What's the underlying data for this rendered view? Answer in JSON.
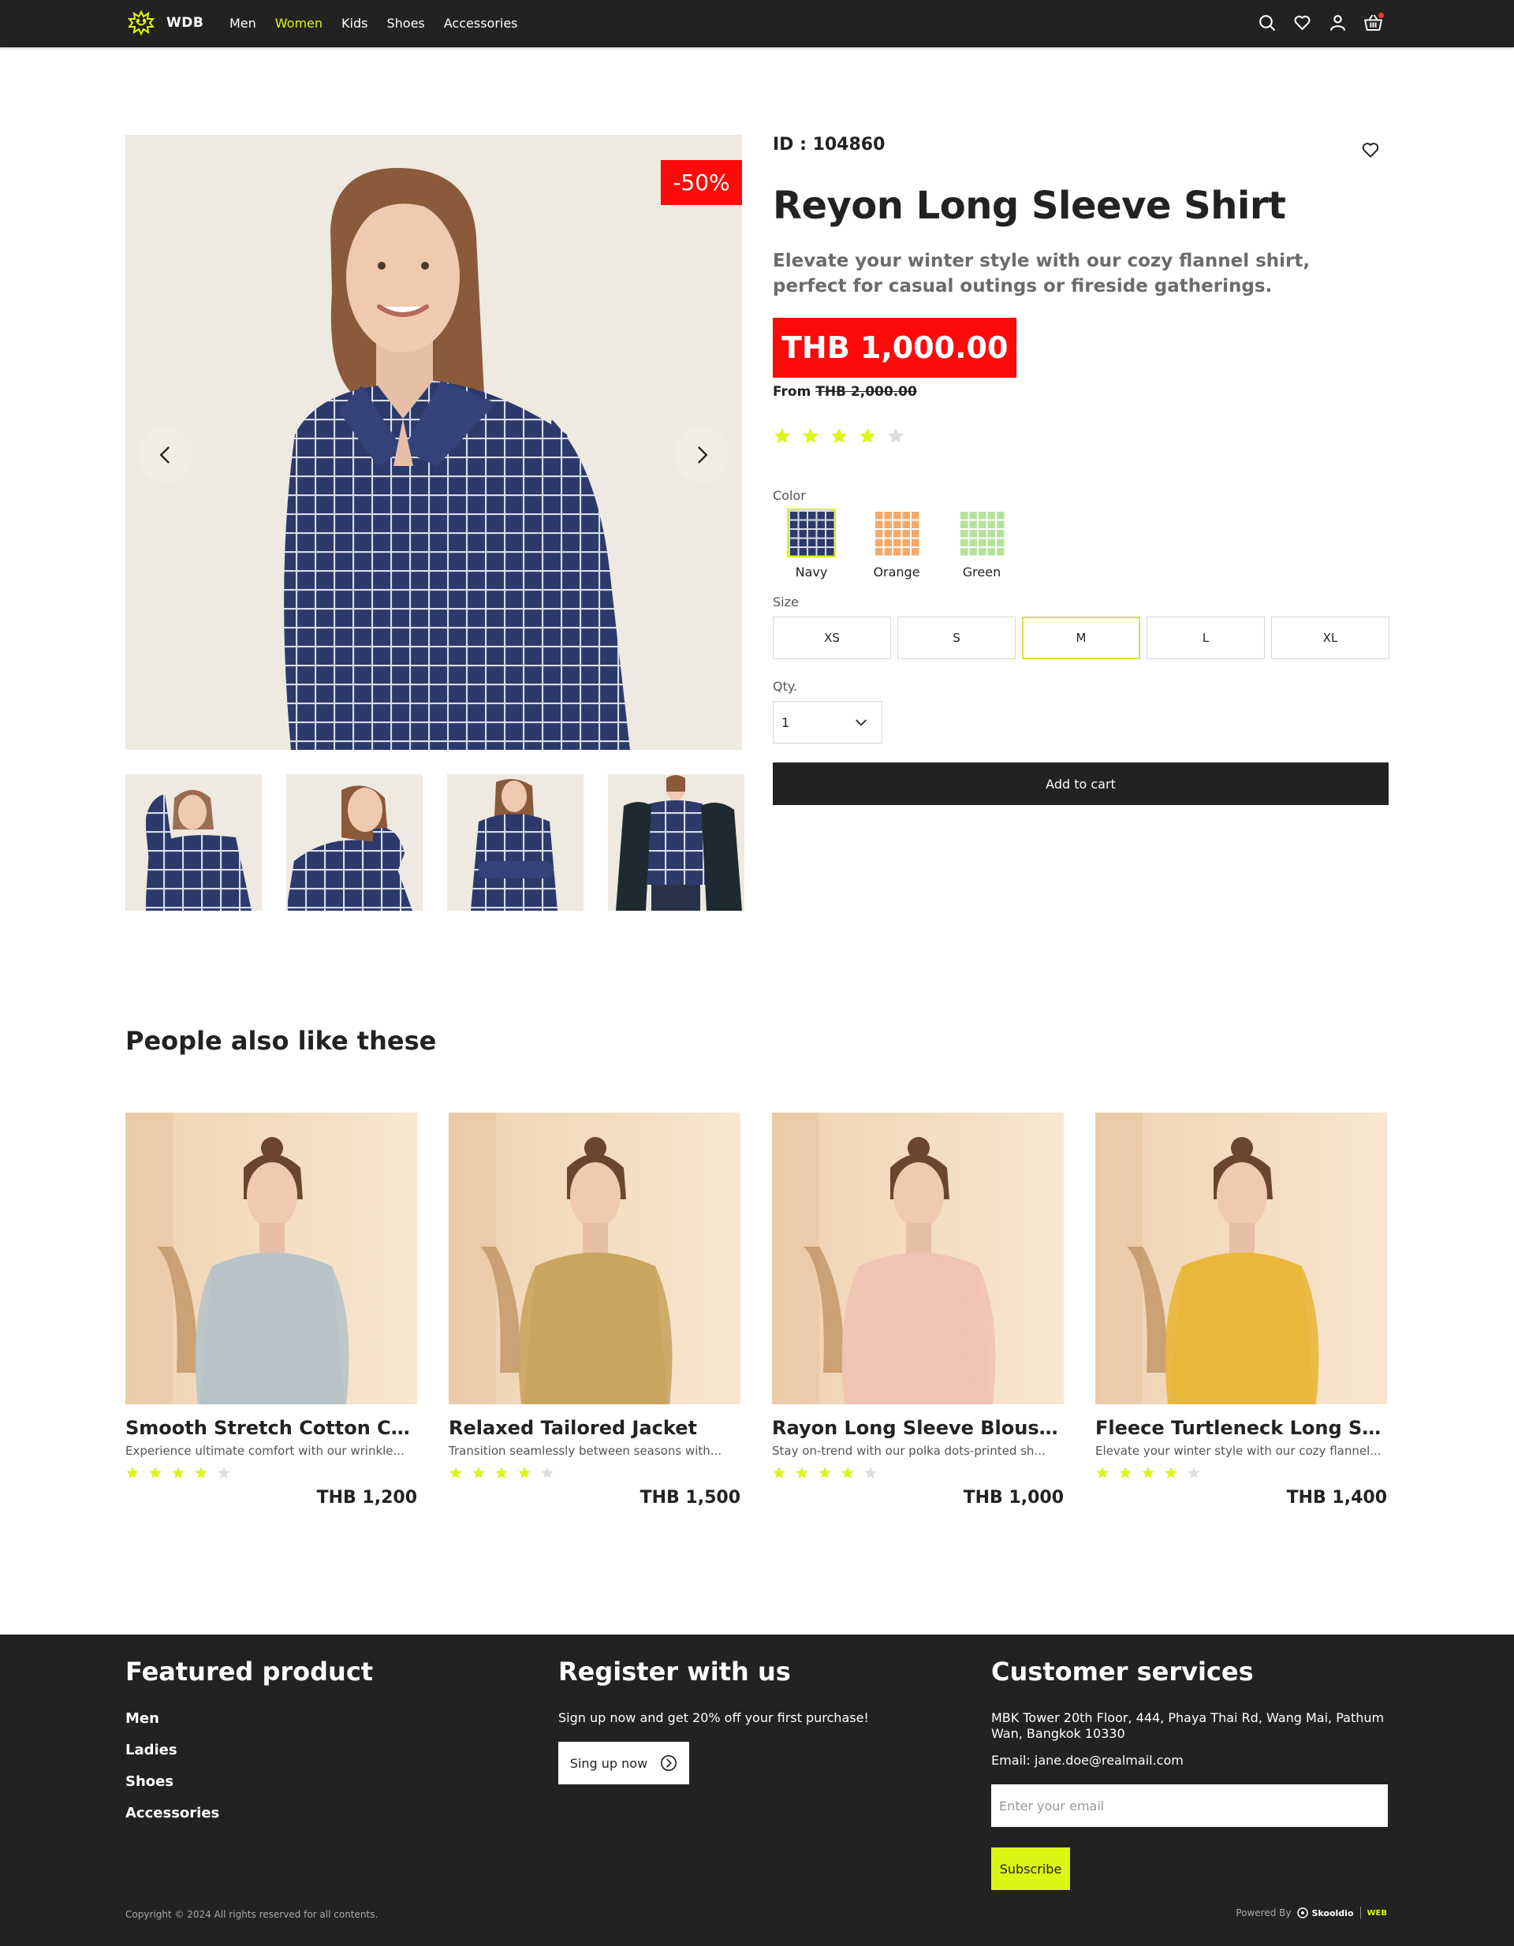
{
  "nav": {
    "brand": "WDB",
    "menu": [
      {
        "label": "Men"
      },
      {
        "label": "Women"
      },
      {
        "label": "Kids"
      },
      {
        "label": "Shoes"
      },
      {
        "label": "Accessories"
      }
    ],
    "active_item": "Women",
    "icons": [
      "search-icon",
      "heart-icon",
      "user-icon",
      "basket-icon"
    ]
  },
  "gallery": {
    "discount_badge": "-50%",
    "thumbnail_count": 4
  },
  "product": {
    "id_label": "ID : 104860",
    "title": "Reyon Long Sleeve Shirt",
    "description": "Elevate your winter style with our cozy flannel shirt, perfect for casual outings or fireside gatherings.",
    "price": "THB 1,000.00",
    "from_label": "From",
    "original_price": "THB 2,000.00",
    "rating": 4,
    "rating_max": 5,
    "color_label": "Color",
    "colors": [
      {
        "name": "Navy",
        "color": "#2c3a6b",
        "line": "#d7dceb"
      },
      {
        "name": "Orange",
        "color": "#f5a86a",
        "line": "#ffffff"
      },
      {
        "name": "Green",
        "color": "#b5e29c",
        "line": "#ffffff"
      }
    ],
    "selected_color": "Navy",
    "size_label": "Size",
    "sizes": [
      "XS",
      "S",
      "M",
      "L",
      "XL"
    ],
    "selected_size": "M",
    "qty_label": "Qty.",
    "qty_value": "1",
    "add_to_cart": "Add to cart"
  },
  "related": {
    "title": "People also like these",
    "items": [
      {
        "title": "Smooth Stretch Cotton Crew...",
        "desc": "Experience ultimate comfort with our wrinkle...",
        "rating": 4,
        "price": "THB 1,200",
        "garment": "#b7c3c9"
      },
      {
        "title": "Relaxed Tailored Jacket",
        "desc": "Transition seamlessly between seasons with...",
        "rating": 4,
        "price": "THB 1,500",
        "garment": "#c9a55f"
      },
      {
        "title": "Rayon Long Sleeve Blouse (P...",
        "desc": "Stay on-trend with our polka dots-printed sh...",
        "rating": 4,
        "price": "THB 1,000",
        "garment": "#f0c3b4"
      },
      {
        "title": "Fleece Turtleneck Long Slee...",
        "desc": "Elevate your winter style with our cozy flannel...",
        "rating": 4,
        "price": "THB 1,400",
        "garment": "#e9b73a"
      }
    ]
  },
  "footer": {
    "featured_title": "Featured product",
    "featured_links": [
      "Men",
      "Ladies",
      "Shoes",
      "Accessories"
    ],
    "register_title": "Register with us",
    "register_text": "Sign up now and get 20% off your first purchase!",
    "signup_button": "Sing up now",
    "service_title": "Customer services",
    "address": "MBK Tower 20th Floor, 444, Phaya Thai Rd, Wang Mai, Pathum Wan, Bangkok 10330",
    "email_line": "Email: jane.doe@realmail.com",
    "email_placeholder": "Enter your email",
    "subscribe_button": "Subscribe",
    "copyright": "Copyright © 2024 All rights reserved for all contents.",
    "powered_by": "Powered By",
    "partner_1": "Skooldio",
    "partner_2": "WEB"
  },
  "colors": {
    "dark": "#222222",
    "accent": "#dcf513",
    "sale": "#ff0a0a",
    "star_on": "#dcf513",
    "star_off": "#dddddd"
  }
}
